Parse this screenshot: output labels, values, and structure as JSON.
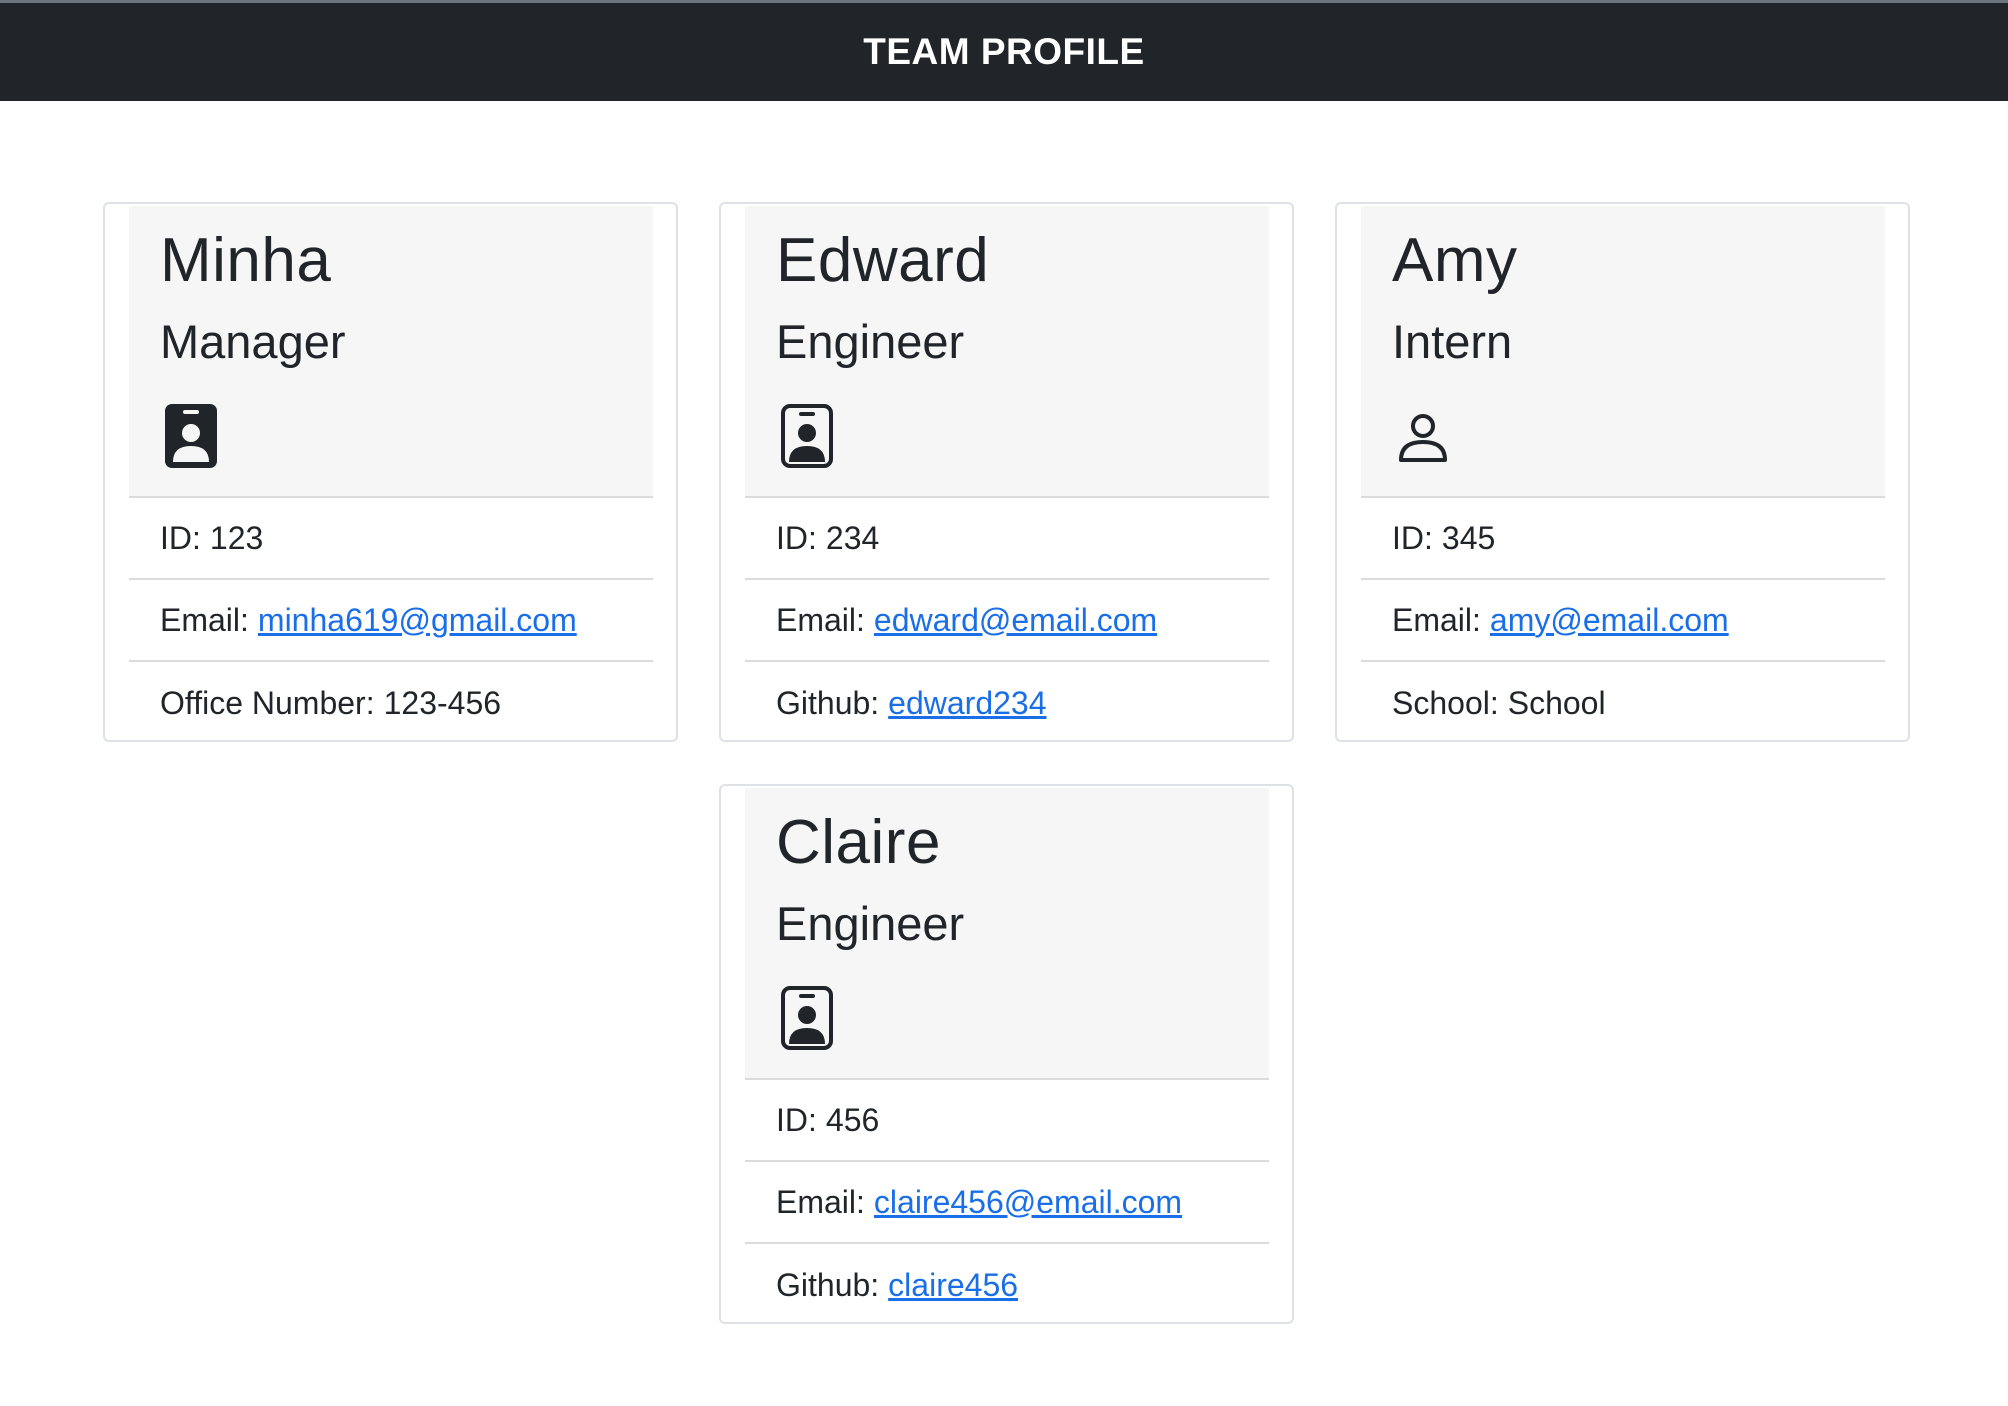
{
  "header": {
    "title": "TEAM PROFILE"
  },
  "cards": [
    {
      "name": "Minha",
      "role": "Manager",
      "icon": "id-badge-icon",
      "id_label": "ID:",
      "id_value": "123",
      "email_label": "Email:",
      "email_value": "minha619@gmail.com",
      "extra_label": "Office Number:",
      "extra_value": "123-456"
    },
    {
      "name": "Edward",
      "role": "Engineer",
      "icon": "id-badge-icon",
      "id_label": "ID:",
      "id_value": "234",
      "email_label": "Email:",
      "email_value": "edward@email.com",
      "extra_label": "Github:",
      "extra_value": "edward234"
    },
    {
      "name": "Amy",
      "role": "Intern",
      "icon": "person-outline-icon",
      "id_label": "ID:",
      "id_value": "345",
      "email_label": "Email:",
      "email_value": "amy@email.com",
      "extra_label": "School:",
      "extra_value": "School"
    },
    {
      "name": "Claire",
      "role": "Engineer",
      "icon": "id-badge-icon",
      "id_label": "ID:",
      "id_value": "456",
      "email_label": "Email:",
      "email_value": "claire456@email.com",
      "extra_label": "Github:",
      "extra_value": "claire456"
    }
  ]
}
